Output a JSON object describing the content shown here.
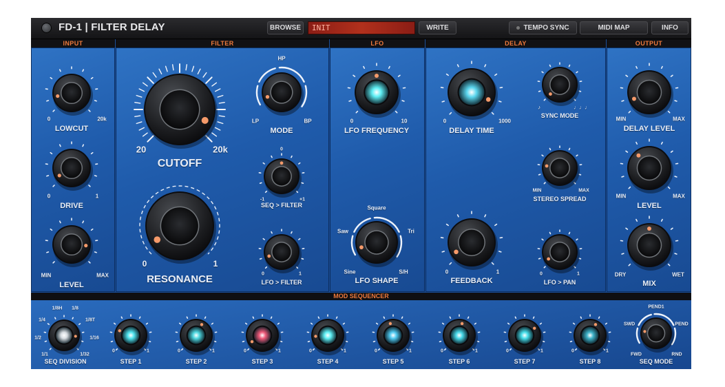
{
  "header": {
    "title": "FD-1 | FILTER DELAY",
    "browse_label": "BROWSE",
    "preset_name": "INIT",
    "write_label": "WRITE",
    "tempo_sync_label": "TEMPO SYNC",
    "midi_map_label": "MIDI MAP",
    "info_label": "INFO"
  },
  "sections": {
    "input": "INPUT",
    "filter": "FILTER",
    "lfo": "LFO",
    "delay": "DELAY",
    "output": "OUTPUT",
    "mod_sequencer": "MOD SEQUENCER"
  },
  "input": {
    "lowcut": {
      "label": "LOWCUT",
      "min": "0",
      "max": "20k"
    },
    "drive": {
      "label": "DRIVE",
      "min": "0",
      "max": "1"
    },
    "level": {
      "label": "LEVEL",
      "min": "MIN",
      "max": "MAX"
    }
  },
  "filter": {
    "cutoff": {
      "label": "CUTOFF",
      "min": "20",
      "max": "20k"
    },
    "resonance": {
      "label": "RESONANCE",
      "min": "0",
      "max": "1"
    },
    "mode": {
      "label": "MODE",
      "lp": "LP",
      "hp": "HP",
      "bp": "BP"
    },
    "seq_filter": {
      "label": "SEQ > FILTER",
      "min": "-1",
      "mid": "0",
      "max": "+1"
    },
    "lfo_filter": {
      "label": "LFO > FILTER",
      "min": "0",
      "max": "1"
    }
  },
  "lfo": {
    "frequency": {
      "label": "LFO FREQUENCY",
      "min": "0",
      "max": "10"
    },
    "shape": {
      "label": "LFO SHAPE",
      "sine": "Sine",
      "saw": "Saw",
      "square": "Square",
      "tri": "Tri",
      "sh": "S/H"
    }
  },
  "delay": {
    "time": {
      "label": "DELAY TIME",
      "min": "0",
      "max": "1000"
    },
    "sync_mode": {
      "label": "SYNC MODE",
      "left_sym": "♪",
      "right_sym": "♩♩♩"
    },
    "stereo_spread": {
      "label": "STEREO SPREAD",
      "min": "MIN",
      "max": "MAX"
    },
    "feedback": {
      "label": "FEEDBACK",
      "min": "0",
      "max": "1"
    },
    "lfo_pan": {
      "label": "LFO > PAN",
      "min": "0",
      "max": "1"
    }
  },
  "output": {
    "delay_level": {
      "label": "DELAY LEVEL",
      "min": "MIN",
      "max": "MAX"
    },
    "level": {
      "label": "LEVEL",
      "min": "MIN",
      "max": "MAX"
    },
    "mix": {
      "label": "MIX",
      "min": "DRY",
      "max": "WET"
    }
  },
  "sequencer": {
    "division": {
      "label": "SEQ DIVISION",
      "options": [
        "1/1",
        "1/2",
        "1/4",
        "1/8H",
        "1/8",
        "1/8T",
        "1/16",
        "1/32"
      ]
    },
    "steps": [
      {
        "label": "STEP 1",
        "min": "0",
        "max": "1",
        "value": 0.25,
        "glow": "#4fe3ee"
      },
      {
        "label": "STEP 2",
        "min": "0",
        "max": "1",
        "value": 0.6,
        "glow": "#4fd8e0"
      },
      {
        "label": "STEP 3",
        "min": "0",
        "max": "1",
        "value": 0.05,
        "glow": "#f05a7a"
      },
      {
        "label": "STEP 4",
        "min": "0",
        "max": "1",
        "value": 0.15,
        "glow": "#5ff0f5"
      },
      {
        "label": "STEP 5",
        "min": "0",
        "max": "1",
        "value": 0.45,
        "glow": "#4fc9f0"
      },
      {
        "label": "STEP 6",
        "min": "0",
        "max": "1",
        "value": 0.55,
        "glow": "#48d8e8"
      },
      {
        "label": "STEP 7",
        "min": "0",
        "max": "1",
        "value": 0.7,
        "glow": "#45dde9"
      },
      {
        "label": "STEP 8",
        "min": "0",
        "max": "1",
        "value": 0.6,
        "glow": "#3fb3c9"
      }
    ],
    "mode": {
      "label": "SEQ MODE",
      "pend1": "PEND1",
      "swd": "SWD",
      "pend": "PEND",
      "fwd": "FWD",
      "rnd": "RND"
    }
  },
  "knob_values": {
    "lowcut": 0.12,
    "drive": 0.05,
    "input_level": 0.85,
    "cutoff": 0.92,
    "resonance": 0.05,
    "mode": 0.1,
    "seq_filter": 0.5,
    "lfo_filter": 0.1,
    "lfo_freq": 0.5,
    "lfo_shape": 0.1,
    "delay_time": 0.92,
    "sync_mode": 0.0,
    "stereo_spread": 0.2,
    "feedback": 0.05,
    "lfo_pan": 0.05,
    "delay_level": 0.08,
    "output_level": 0.35,
    "mix": 0.5,
    "seq_division": 0.85,
    "seq_mode": 0.2
  },
  "colors": {
    "accent": "#f07a3c",
    "panel_blue": "#1f5bab",
    "preset_red": "#b1301c",
    "knob_dot": "#f59a6a",
    "lfo_glow": "#5ff0f5",
    "delay_glow": "#5ad6ee"
  }
}
